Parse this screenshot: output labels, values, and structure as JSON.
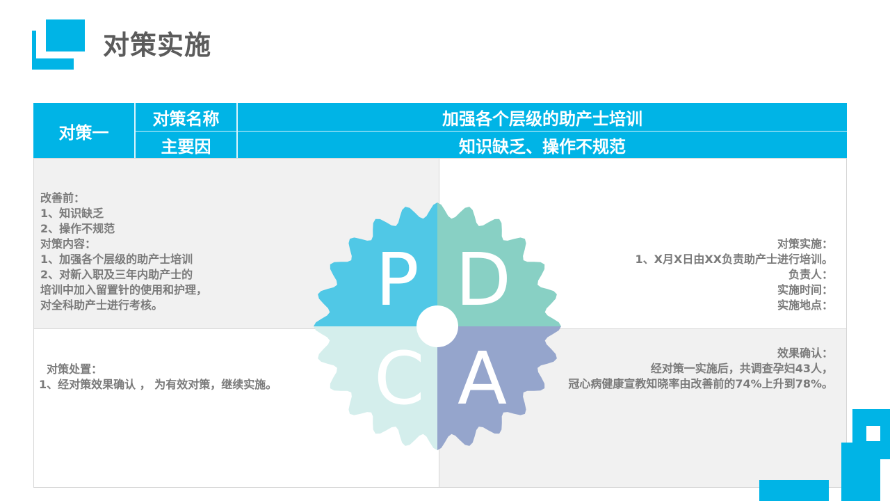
{
  "page": {
    "title": "对策实施"
  },
  "colors": {
    "accent": "#00b4e6",
    "plan": "#50c8e6",
    "do": "#88d0c4",
    "check": "#d4eeec",
    "act": "#95a5cc"
  },
  "header": {
    "measure": "对策一",
    "name_label": "对策名称",
    "name_value": "加强各个层级的助产士培训",
    "cause_label": "主要因",
    "cause_value": "知识缺乏、操作不规范"
  },
  "pdca": {
    "p": "P",
    "d": "D",
    "c": "C",
    "a": "A"
  },
  "plan_box": {
    "lines": [
      "改善前：",
      "1、知识缺乏",
      "2、操作不规范",
      "对策内容：",
      "1、加强各个层级的助产士培训",
      "2、对新入职及三年内助产士的",
      "培训中加入留置针的使用和护理，",
      "对全科助产士进行考核。"
    ]
  },
  "do_box": {
    "lines": [
      "对策实施：",
      "1、X月X日由XX负责助产士进行培训。",
      "负责人：",
      "实施时间：",
      "实施地点："
    ]
  },
  "act_box": {
    "lines": [
      "  对策处置：",
      "1、经对策效果确认 ， 为有效对策，继续实施。"
    ]
  },
  "check_box": {
    "lines": [
      "效果确认：",
      "经对策一实施后，共调查孕妇43人，",
      "冠心病健康宣教知晓率由改善前的74%上升到78%。"
    ]
  }
}
